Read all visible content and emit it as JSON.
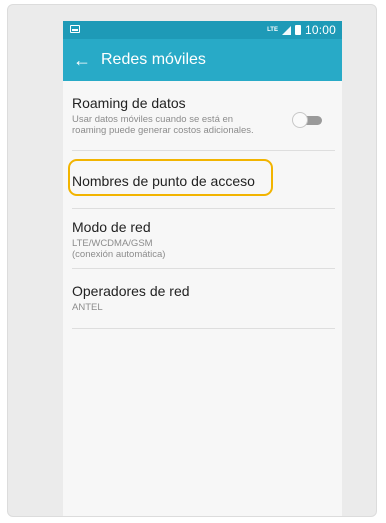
{
  "status_bar": {
    "network_type": "LTE",
    "time": "10:00"
  },
  "app_bar": {
    "back_icon": "arrow-left-icon",
    "title": "Redes móviles"
  },
  "settings": {
    "roaming": {
      "title": "Roaming de datos",
      "subtitle_line1": "Usar datos móviles cuando se está en",
      "subtitle_line2": "roaming puede generar costos adicionales.",
      "enabled": false
    },
    "apn": {
      "title": "Nombres de punto de acceso",
      "highlight_color": "#f2b400"
    },
    "network_mode": {
      "title": "Modo de red",
      "value": "LTE/WCDMA/GSM",
      "detail": "(conexión automática)"
    },
    "operators": {
      "title": "Operadores de red",
      "value": "ANTEL"
    }
  },
  "colors": {
    "status_bar": "#1e9ab7",
    "app_bar": "#28aac7"
  }
}
